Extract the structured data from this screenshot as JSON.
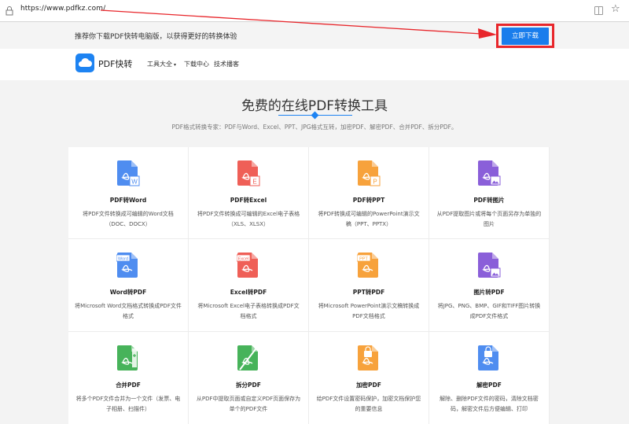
{
  "browser": {
    "url": "https://www.pdfkz.com/"
  },
  "notice": {
    "text": "推荐你下载PDF快转电脑版，以获得更好的转换体验",
    "download_label": "立即下载"
  },
  "header": {
    "logo_text": "PDF快转",
    "nav": [
      {
        "label": "工具大全",
        "caret": "▾"
      },
      {
        "label": "下载中心"
      },
      {
        "label": "技术播客"
      }
    ]
  },
  "hero": {
    "title": "免费的在线PDF转换工具",
    "subtitle": "PDF格式转换专家：PDF与Word、Excel、PPT、JPG格式互转，加密PDF、解密PDF、合并PDF、拆分PDF。"
  },
  "tools": [
    {
      "title": "PDF转Word",
      "desc": "将PDF文件转换成可编辑的Word文档（DOC、DOCX）",
      "icon": "pdf-to-word-icon",
      "color": "#4f8df0",
      "badge": "W"
    },
    {
      "title": "PDF转Excel",
      "desc": "将PDF文件转换成可编辑的Excel电子表格（XLS、XLSX）",
      "icon": "pdf-to-excel-icon",
      "color": "#ef5f57",
      "badge": "E"
    },
    {
      "title": "PDF转PPT",
      "desc": "将PDF转换成可编辑的PowerPoint演示文稿（PPT、PPTX）",
      "icon": "pdf-to-ppt-icon",
      "color": "#f7a23c",
      "badge": "P"
    },
    {
      "title": "PDF转图片",
      "desc": "从PDF提取图片或将每个页面另存为单独的图片",
      "icon": "pdf-to-image-icon",
      "color": "#8a5fd9",
      "badge": "img"
    },
    {
      "title": "Word转PDF",
      "desc": "将Microsoft Word文档格式转换成PDF文件格式",
      "icon": "word-to-pdf-icon",
      "color": "#4f8df0",
      "badge": "Word"
    },
    {
      "title": "Excel转PDF",
      "desc": "将Microsoft Excel电子表格转换成PDF文档格式",
      "icon": "excel-to-pdf-icon",
      "color": "#ef5f57",
      "badge": "Excel"
    },
    {
      "title": "PPT转PDF",
      "desc": "将Microsoft PowerPoint演示文稿转换成PDF文档格式",
      "icon": "ppt-to-pdf-icon",
      "color": "#f7a23c",
      "badge": "PPT"
    },
    {
      "title": "图片转PDF",
      "desc": "将JPG、PNG、BMP、GIF和TIFF图片转换成PDF文件格式",
      "icon": "image-to-pdf-icon",
      "color": "#8a5fd9",
      "badge": "img"
    },
    {
      "title": "合并PDF",
      "desc": "将多个PDF文件合并为一个文件（发票、电子相册、扫描件）",
      "icon": "merge-pdf-icon",
      "color": "#47b35a",
      "badge": "merge"
    },
    {
      "title": "拆分PDF",
      "desc": "从PDF中提取页面或自定义PDF页面保存为单个的PDF文件",
      "icon": "split-pdf-icon",
      "color": "#47b35a",
      "badge": "split"
    },
    {
      "title": "加密PDF",
      "desc": "给PDF文件设置密码保护，加密文档保护您的重要信息",
      "icon": "encrypt-pdf-icon",
      "color": "#f7a23c",
      "badge": "lock"
    },
    {
      "title": "解密PDF",
      "desc": "解除、删除PDF文件的密码，清除文档密码，解密文件后方便编辑、打印",
      "icon": "decrypt-pdf-icon",
      "color": "#4f8df0",
      "badge": "unlock"
    }
  ]
}
